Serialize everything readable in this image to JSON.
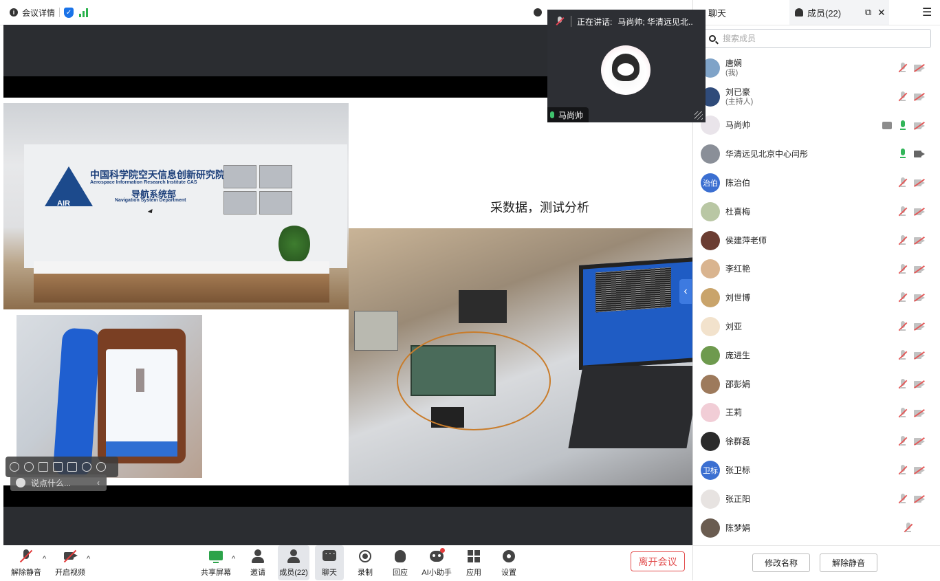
{
  "topbar": {
    "meeting_info_label": "会议详情",
    "info_icon": "info-circle-icon",
    "shield_icon": "shield-check-icon",
    "signal_icon": "signal-bars-icon",
    "clock_icon": "clock-icon",
    "signal_color": "#2bb24c"
  },
  "speaker_tile": {
    "speaking_prefix": "正在讲话:",
    "speaking_names": "马尚帅; 华清远见北..",
    "name": "马尚帅"
  },
  "slide": {
    "caption": "采数据，测试分析",
    "institute_cn": "中国科学院空天信息创新研究院",
    "institute_en": "Aerospace Information Research Institute CAS",
    "department_cn": "导航系统部",
    "department_en": "Navigation System Department",
    "logo_text": "AIR"
  },
  "overlay": {
    "chat_placeholder": "说点什么..."
  },
  "toolbar": {
    "unmute": "解除静音",
    "start_video": "开启视频",
    "share_screen": "共享屏幕",
    "invite": "邀请",
    "members": "成员(22)",
    "chat": "聊天",
    "record": "录制",
    "react": "回应",
    "ai_assistant": "AI小助手",
    "apps": "应用",
    "settings": "设置",
    "leave": "离开会议",
    "leave_color": "#e24c4c"
  },
  "panel": {
    "tab_chat": "聊天",
    "tab_members": "成员(22)",
    "search_placeholder": "搜索成员",
    "rename_button": "修改名称",
    "unmute_button": "解除静音",
    "members": [
      {
        "name": "唐娴",
        "role": "(我)",
        "avatar_color": "#7fa3c8",
        "avatar_text": "",
        "mic": "off",
        "cam": "off",
        "share": false
      },
      {
        "name": "刘已豪",
        "role": "(主持人)",
        "avatar_color": "#2f4b7a",
        "avatar_text": "",
        "mic": "off",
        "cam": "off",
        "share": false
      },
      {
        "name": "马尚帅",
        "role": "",
        "avatar_color": "#e9e4ea",
        "avatar_text": "",
        "mic": "on",
        "cam": "off",
        "share": true
      },
      {
        "name": "华清远见北京中心闫彤",
        "role": "",
        "avatar_color": "#8a8f98",
        "avatar_text": "",
        "mic": "on",
        "cam": "on",
        "share": false
      },
      {
        "name": "陈治伯",
        "role": "",
        "avatar_color": "#3b6fd1",
        "avatar_text": "治伯",
        "mic": "off",
        "cam": "off",
        "share": false
      },
      {
        "name": "杜喜梅",
        "role": "",
        "avatar_color": "#b9c7a4",
        "avatar_text": "",
        "mic": "off",
        "cam": "off",
        "share": false
      },
      {
        "name": "侯建萍老师",
        "role": "",
        "avatar_color": "#6b3d32",
        "avatar_text": "",
        "mic": "off",
        "cam": "off",
        "share": false
      },
      {
        "name": "李红艳",
        "role": "",
        "avatar_color": "#d9b48f",
        "avatar_text": "",
        "mic": "off",
        "cam": "off",
        "share": false
      },
      {
        "name": "刘世博",
        "role": "",
        "avatar_color": "#c9a46b",
        "avatar_text": "",
        "mic": "off",
        "cam": "off",
        "share": false
      },
      {
        "name": "刘亚",
        "role": "",
        "avatar_color": "#f2e2cc",
        "avatar_text": "",
        "mic": "off",
        "cam": "off",
        "share": false
      },
      {
        "name": "庞进生",
        "role": "",
        "avatar_color": "#6e9a4e",
        "avatar_text": "",
        "mic": "off",
        "cam": "off",
        "share": false
      },
      {
        "name": "邵彭娟",
        "role": "",
        "avatar_color": "#9d7a5c",
        "avatar_text": "",
        "mic": "off",
        "cam": "off",
        "share": false
      },
      {
        "name": "王莉",
        "role": "",
        "avatar_color": "#f1cdd6",
        "avatar_text": "",
        "mic": "off",
        "cam": "off",
        "share": false
      },
      {
        "name": "徐群磊",
        "role": "",
        "avatar_color": "#2b2b2b",
        "avatar_text": "",
        "mic": "off",
        "cam": "off",
        "share": false
      },
      {
        "name": "张卫标",
        "role": "",
        "avatar_color": "#3b6fd1",
        "avatar_text": "卫标",
        "mic": "off",
        "cam": "off",
        "share": false
      },
      {
        "name": "张正阳",
        "role": "",
        "avatar_color": "#e7e3e1",
        "avatar_text": "",
        "mic": "off",
        "cam": "off",
        "share": false
      },
      {
        "name": "陈梦娟",
        "role": "",
        "avatar_color": "#6a5c50",
        "avatar_text": "",
        "mic": "off",
        "cam": "none",
        "share": false
      }
    ]
  }
}
